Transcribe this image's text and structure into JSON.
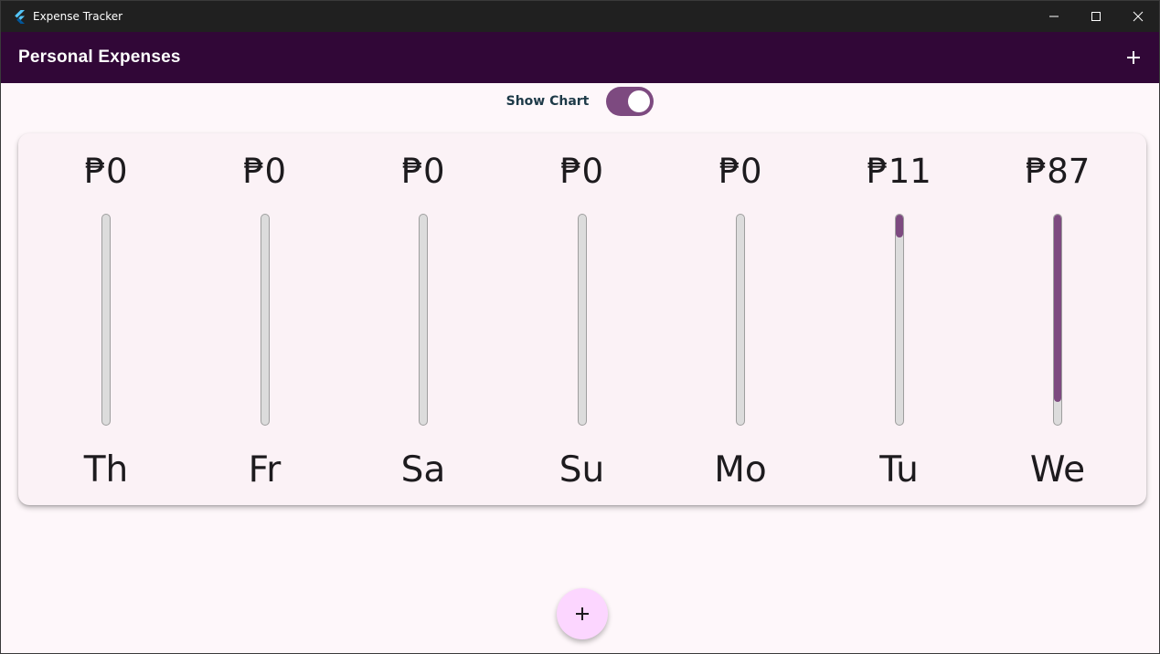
{
  "window": {
    "title": "Expense Tracker",
    "controls": [
      "minimize-icon",
      "maximize-icon",
      "close-icon"
    ]
  },
  "appbar": {
    "title": "Personal Expenses",
    "add_icon": "plus-icon"
  },
  "toggle": {
    "label": "Show Chart",
    "checked": true
  },
  "colors": {
    "appbar_bg": "#310737",
    "accent": "#7d4a80",
    "fab_bg": "#fcd6ff",
    "page_bg": "#fef7fa"
  },
  "chart_data": {
    "type": "bar",
    "categories": [
      "Th",
      "Fr",
      "Sa",
      "Su",
      "Mo",
      "Tu",
      "We"
    ],
    "amount_labels": [
      "₱0",
      "₱0",
      "₱0",
      "₱0",
      "₱0",
      "₱11",
      "₱87"
    ],
    "values": [
      0,
      0,
      0,
      0,
      0,
      11,
      87
    ],
    "fill_fraction": [
      0,
      0,
      0,
      0,
      0,
      0.11,
      0.89
    ]
  },
  "fab": {
    "icon": "plus-icon"
  }
}
